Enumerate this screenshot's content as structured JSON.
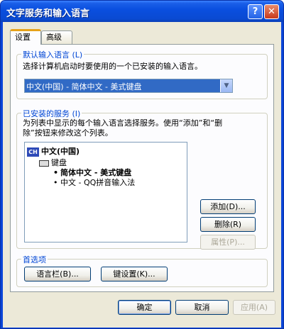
{
  "window": {
    "title": "文字服务和输入语言",
    "help_glyph": "?",
    "close_glyph": "✕"
  },
  "tabs": [
    {
      "label": "设置",
      "active": true
    },
    {
      "label": "高级",
      "active": false
    }
  ],
  "default_language": {
    "group_label": "默认输入语言 (L)",
    "description": "选择计算机启动时要使用的一个已安装的输入语言。",
    "selected_value": "中文(中国) - 简体中文 - 美式键盘",
    "arrow_glyph": "▼"
  },
  "installed_services": {
    "group_label": "已安装的服务 (I)",
    "description_lines": [
      "为列表中显示的每个输入语言选择服务。使用“添加”和“删",
      "除”按钮来修改这个列表。"
    ],
    "tree": {
      "language_icon": "CH",
      "language": "中文(中国)",
      "category": "键盘",
      "items": [
        {
          "label": "简体中文 - 美式键盘",
          "bold": true,
          "bullet": "•"
        },
        {
          "label": "中文 - QQ拼音输入法",
          "bold": false,
          "bullet": "•"
        }
      ]
    },
    "buttons": {
      "add": "添加(D)...",
      "remove": "删除(R)",
      "properties": "属性(P)..."
    }
  },
  "preferences": {
    "group_label": "首选项",
    "language_bar_button": "语言栏(B)...",
    "key_settings_button": "键设置(K)..."
  },
  "footer": {
    "ok": "确定",
    "cancel": "取消",
    "apply": "应用(A)"
  }
}
